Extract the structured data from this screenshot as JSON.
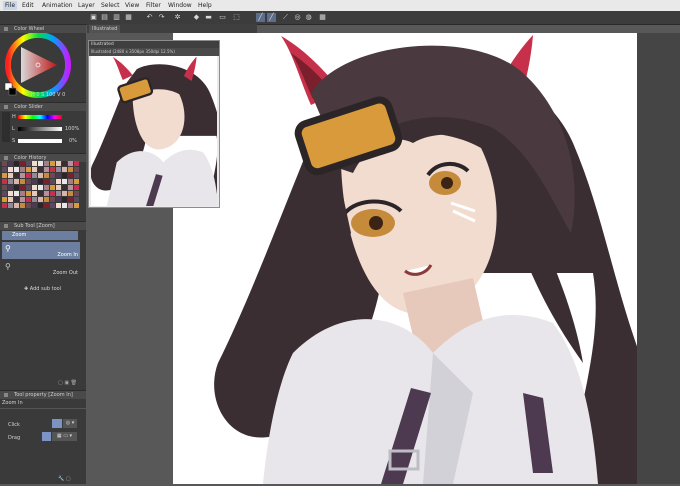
{
  "menu": [
    "File",
    "Edit",
    "Animation",
    "Layer",
    "Select",
    "View",
    "Filter",
    "Window",
    "Help"
  ],
  "toolbar_icons": [
    "new-file-icon",
    "folder-icon",
    "save-icon",
    "undo-icon",
    "redo-icon",
    "settings-icon",
    "fill-icon",
    "eraser-icon",
    "brush-icon",
    "select-icon",
    "pen-icon",
    "circle-icon",
    "layer-icon"
  ],
  "color_wheel": {
    "title": "Color Wheel",
    "readout_h": "0",
    "readout_s": "100",
    "readout_v": "0"
  },
  "color_slider": {
    "title": "Color Slider",
    "h": "H",
    "l": "L",
    "s": "S",
    "l_val": "100%",
    "s_val": "0%"
  },
  "color_history": {
    "title": "Color History"
  },
  "sub_tool": {
    "title": "Sub Tool [Zoom]",
    "group": "Zoom",
    "zoom_in": "Zoom In",
    "zoom_out": "Zoom Out",
    "add": "Add sub tool"
  },
  "tool_property": {
    "title": "Tool property [Zoom In]",
    "tool": "Zoom In",
    "click": "Click",
    "drag": "Drag"
  },
  "navigator": {
    "title": "Illustrated",
    "subtitle": "Illustrated (2480 x 3508px 350dpi 12.5%)"
  },
  "canvas_tab": {
    "title": "Illustrated"
  },
  "colors": {
    "accent": "#5c6e8c",
    "hair": "#3b2e33",
    "ears": "#c6304a",
    "goggles": "#d89a3a",
    "skin": "#f2dccf",
    "shirt": "#e8e6ea",
    "strap": "#4d3950"
  }
}
